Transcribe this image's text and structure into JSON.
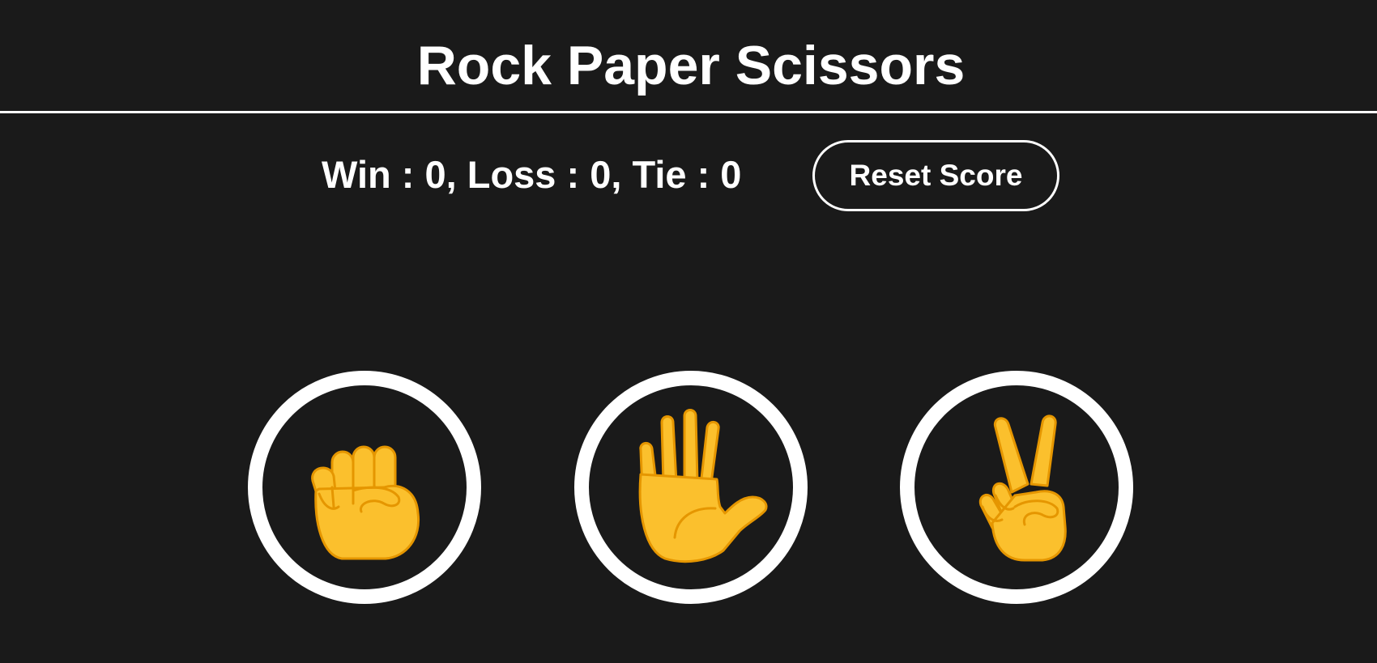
{
  "header": {
    "title": "Rock Paper Scissors"
  },
  "scoreboard": {
    "text": "Win : 0, Loss : 0, Tie : 0",
    "wins": 0,
    "losses": 0,
    "ties": 0
  },
  "controls": {
    "reset_label": "Reset Score"
  },
  "choices": [
    {
      "name": "rock",
      "icon": "raised-fist-icon"
    },
    {
      "name": "paper",
      "icon": "raised-hand-icon"
    },
    {
      "name": "scissors",
      "icon": "victory-hand-icon"
    }
  ],
  "colors": {
    "background": "#1a1a1a",
    "foreground": "#ffffff",
    "hand_fill": "#FBC02D",
    "hand_line": "#E59600"
  }
}
